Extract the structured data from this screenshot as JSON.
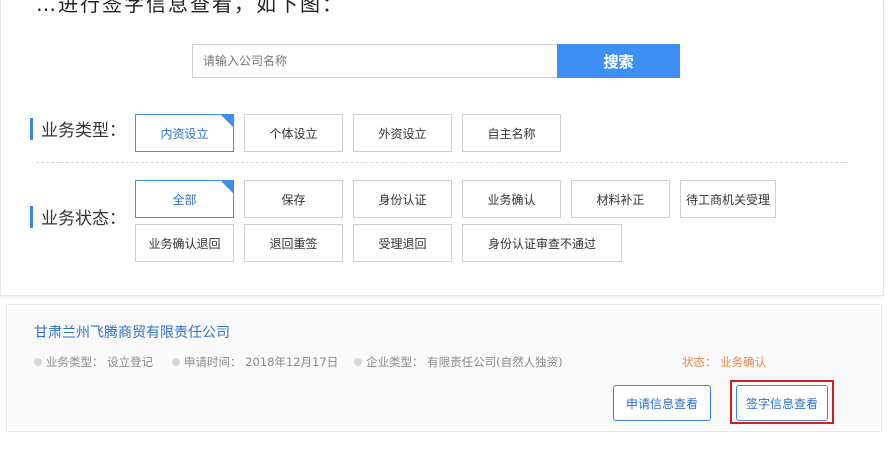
{
  "caption_fragment": "…进行签字信息查看，如下图：",
  "search": {
    "placeholder": "请输入公司名称",
    "button_label": "搜索"
  },
  "business_type": {
    "label": "业务类型：",
    "options": [
      "内资设立",
      "个体设立",
      "外资设立",
      "自主名称"
    ],
    "selected": "内资设立"
  },
  "business_status": {
    "label": "业务状态：",
    "options": [
      "全部",
      "保存",
      "身份认证",
      "业务确认",
      "材料补正",
      "待工商机关受理",
      "业务确认退回",
      "退回重签",
      "受理退回",
      "身份认证审查不通过"
    ],
    "selected": "全部"
  },
  "result": {
    "company_name": "甘肃兰州飞腾商贸有限责任公司",
    "business_type": "业务类型： 设立登记",
    "apply_time": "申请时间： 2018年12月17日",
    "enterprise_type": "企业类型： 有限责任公司(自然人独资)",
    "status": "状态： 业务确认",
    "buttons": {
      "apply_info": "申请信息查看",
      "signature_info": "签字信息查看"
    }
  },
  "colors": {
    "accent": "#3d8ff3",
    "link": "#2f6fd0",
    "status": "#e8874a",
    "highlight": "#d21f1f"
  }
}
